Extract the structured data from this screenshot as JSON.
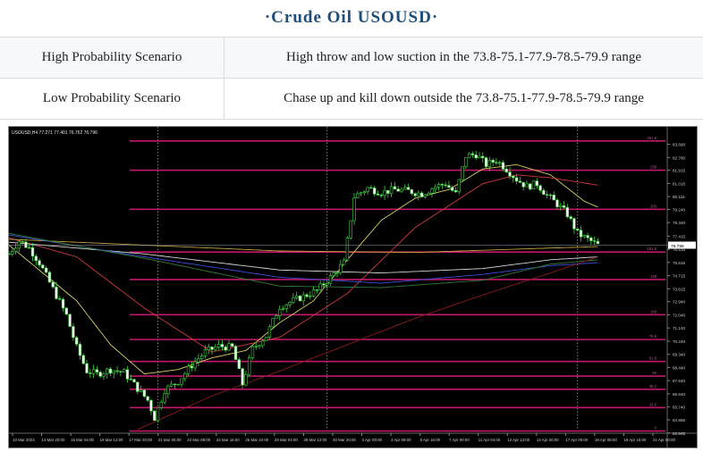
{
  "header": {
    "title": "·Crude Oil USOUSD·"
  },
  "scenarios": [
    {
      "label": "High Probability Scenario",
      "text": "High throw and low suction in the 73.8-75.1-77.9-78.5-79.9 range"
    },
    {
      "label": "Low Probability Scenario",
      "text": "Chase up and kill down outside the 73.8-75.1-77.9-78.5-79.9 range"
    }
  ],
  "chart_data": {
    "type": "line",
    "title": "USOUSD,H4  77.271 77.401 76.762 76.796",
    "current_price_label": "76.796",
    "ylim": [
      63.95,
      84.15
    ],
    "y_ticks": [
      "83.690",
      "82.790",
      "81.915",
      "81.015",
      "80.115",
      "79.240",
      "78.340",
      "77.415",
      "76.515",
      "75.615",
      "74.715",
      "73.815",
      "72.940",
      "72.040",
      "71.140",
      "70.240",
      "69.340",
      "68.440",
      "67.540",
      "66.640",
      "65.740",
      "64.865",
      "63.965"
    ],
    "x_ticks": [
      "10 Mar 2023",
      "13 Mar 20:00",
      "15 Mar 04:00",
      "16 Mar 12:00",
      "17 Mar 20:00",
      "21 Mar 00:00",
      "22 Mar 08:00",
      "23 Mar 16:00",
      "26 Mar 22:00",
      "28 Mar 04:00",
      "29 Mar 12:00",
      "30 Mar 20:00",
      "3 Apr 00:00",
      "4 Apr 08:00",
      "5 Apr 16:00",
      "7 Apr 00:00",
      "11 Apr 04:00",
      "12 Apr 12:00",
      "13 Apr 20:00",
      "17 Apr 00:00",
      "18 Apr 08:00",
      "19 Apr 16:00",
      "21 Apr 00:00"
    ],
    "x_count": 132,
    "fib_levels": [
      {
        "tag": "261.8",
        "price": 83.92,
        "color": "#c2186b"
      },
      {
        "tag": "238",
        "price": 81.92,
        "color": "#c2186b"
      },
      {
        "tag": "200",
        "price": 79.25,
        "color": "#c2186b"
      },
      {
        "tag": "161.8",
        "price": 76.33,
        "color": "#c2186b"
      },
      {
        "tag": "138",
        "price": 74.45,
        "color": "#c2186b"
      },
      {
        "tag": "100",
        "price": 72.05,
        "color": "#c2186b"
      },
      {
        "tag": "78.6",
        "price": 70.35,
        "color": "#c2186b"
      },
      {
        "tag": "61.8",
        "price": 68.85,
        "color": "#c2186b"
      },
      {
        "tag": "50",
        "price": 67.85,
        "color": "#c2186b"
      },
      {
        "tag": "38.2",
        "price": 66.95,
        "color": "#c2186b"
      },
      {
        "tag": "23.6",
        "price": 65.7,
        "color": "#c2186b"
      },
      {
        "tag": "0",
        "price": 64.1,
        "color": "#c2186b"
      }
    ],
    "close_anchors": [
      [
        0,
        76.2
      ],
      [
        3,
        77.1
      ],
      [
        6,
        76.6
      ],
      [
        9,
        75.6
      ],
      [
        13,
        73.8
      ],
      [
        17,
        72.0
      ],
      [
        20,
        69.8
      ],
      [
        23,
        68.2
      ],
      [
        26,
        68.0
      ],
      [
        30,
        68.3
      ],
      [
        34,
        68.1
      ],
      [
        38,
        67.0
      ],
      [
        41,
        66.2
      ],
      [
        43,
        65.0
      ],
      [
        46,
        66.9
      ],
      [
        50,
        67.5
      ],
      [
        54,
        68.6
      ],
      [
        58,
        69.5
      ],
      [
        62,
        69.9
      ],
      [
        66,
        69.8
      ],
      [
        69,
        67.3
      ],
      [
        72,
        69.7
      ],
      [
        76,
        70.6
      ],
      [
        80,
        72.6
      ],
      [
        84,
        73.0
      ],
      [
        88,
        73.4
      ],
      [
        91,
        73.7
      ],
      [
        95,
        74.6
      ],
      [
        99,
        75.6
      ],
      [
        102,
        80.1
      ],
      [
        106,
        80.7
      ],
      [
        110,
        80.4
      ],
      [
        114,
        80.6
      ],
      [
        118,
        80.5
      ],
      [
        122,
        80.3
      ],
      [
        126,
        80.8
      ],
      [
        129,
        81.0
      ],
      [
        132,
        80.3
      ],
      [
        135,
        82.9
      ],
      [
        138,
        83.0
      ],
      [
        141,
        82.3
      ],
      [
        144,
        82.6
      ],
      [
        147,
        82.0
      ],
      [
        150,
        81.3
      ],
      [
        153,
        80.8
      ],
      [
        156,
        81.0
      ],
      [
        159,
        80.2
      ],
      [
        162,
        79.6
      ],
      [
        165,
        78.9
      ],
      [
        168,
        77.6
      ],
      [
        171,
        77.2
      ],
      [
        174,
        76.8
      ]
    ],
    "ma_series": [
      {
        "color": "#d8d060",
        "points": [
          [
            0,
            76.8
          ],
          [
            20,
            73.0
          ],
          [
            30,
            70.0
          ],
          [
            40,
            68.0
          ],
          [
            50,
            68.3
          ],
          [
            60,
            69.1
          ],
          [
            70,
            69.6
          ],
          [
            80,
            71.5
          ],
          [
            90,
            73.0
          ],
          [
            100,
            75.8
          ],
          [
            110,
            78.5
          ],
          [
            120,
            80.0
          ],
          [
            130,
            80.6
          ],
          [
            140,
            82.0
          ],
          [
            150,
            82.3
          ],
          [
            160,
            81.6
          ],
          [
            170,
            79.8
          ],
          [
            174,
            79.4
          ]
        ]
      },
      {
        "color": "#d03a3a",
        "points": [
          [
            0,
            77.3
          ],
          [
            20,
            76.0
          ],
          [
            40,
            72.5
          ],
          [
            60,
            69.5
          ],
          [
            80,
            70.5
          ],
          [
            100,
            73.5
          ],
          [
            120,
            78.0
          ],
          [
            140,
            81.0
          ],
          [
            150,
            81.6
          ],
          [
            160,
            81.4
          ],
          [
            174,
            80.9
          ]
        ]
      },
      {
        "color": "#c8a040",
        "points": [
          [
            0,
            77.2
          ],
          [
            40,
            76.8
          ],
          [
            80,
            76.4
          ],
          [
            120,
            76.3
          ],
          [
            160,
            76.6
          ],
          [
            174,
            76.7
          ]
        ]
      },
      {
        "color": "#d8d8d8",
        "points": [
          [
            0,
            77.0
          ],
          [
            40,
            76.2
          ],
          [
            80,
            75.1
          ],
          [
            110,
            74.9
          ],
          [
            140,
            75.2
          ],
          [
            160,
            75.8
          ],
          [
            174,
            76.0
          ]
        ]
      },
      {
        "color": "#3a4fd8",
        "points": [
          [
            0,
            77.5
          ],
          [
            40,
            76.0
          ],
          [
            80,
            74.6
          ],
          [
            110,
            74.2
          ],
          [
            140,
            74.8
          ],
          [
            160,
            75.4
          ],
          [
            174,
            75.6
          ]
        ]
      },
      {
        "color": "#2e7d32",
        "points": [
          [
            0,
            77.6
          ],
          [
            40,
            75.9
          ],
          [
            80,
            74.0
          ],
          [
            110,
            73.9
          ],
          [
            140,
            74.4
          ],
          [
            160,
            75.5
          ],
          [
            174,
            75.8
          ]
        ]
      },
      {
        "color": "#8b1a1a",
        "points": [
          [
            38,
            64.2
          ],
          [
            60,
            66.5
          ],
          [
            80,
            68.2
          ],
          [
            100,
            70.0
          ],
          [
            120,
            71.8
          ],
          [
            140,
            73.4
          ],
          [
            160,
            74.9
          ],
          [
            174,
            76.0
          ]
        ]
      }
    ],
    "vlines": [
      44,
      94,
      168
    ]
  }
}
